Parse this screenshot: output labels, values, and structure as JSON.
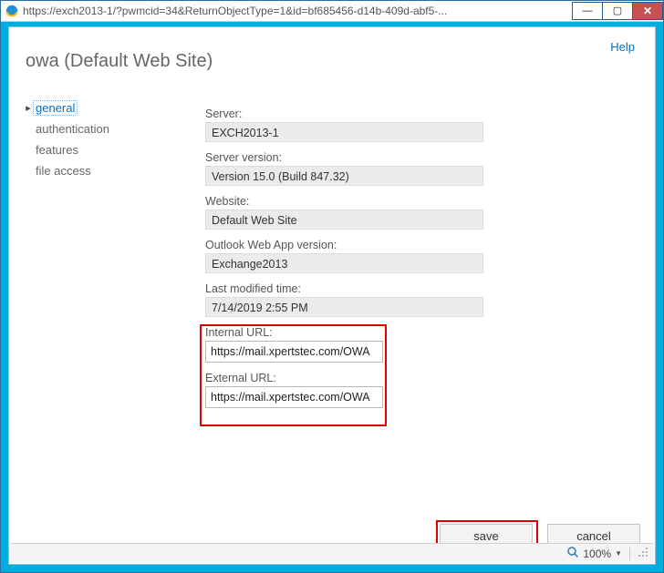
{
  "window": {
    "url": "https://exch2013-1/?pwmcid=34&ReturnObjectType=1&id=bf685456-d14b-409d-abf5-..."
  },
  "header": {
    "help": "Help",
    "title": "owa (Default Web Site)"
  },
  "nav": {
    "items": [
      {
        "label": "general",
        "selected": true
      },
      {
        "label": "authentication",
        "selected": false
      },
      {
        "label": "features",
        "selected": false
      },
      {
        "label": "file access",
        "selected": false
      }
    ]
  },
  "form": {
    "server_label": "Server:",
    "server_value": "EXCH2013-1",
    "server_version_label": "Server version:",
    "server_version_value": "Version 15.0 (Build 847.32)",
    "website_label": "Website:",
    "website_value": "Default Web Site",
    "owa_version_label": "Outlook Web App version:",
    "owa_version_value": "Exchange2013",
    "last_modified_label": "Last modified time:",
    "last_modified_value": "7/14/2019 2:55 PM",
    "internal_url_label": "Internal URL:",
    "internal_url_value": "https://mail.xpertstec.com/OWA",
    "external_url_label": "External URL:",
    "external_url_value": "https://mail.xpertstec.com/OWA"
  },
  "buttons": {
    "save": "save",
    "cancel": "cancel"
  },
  "status": {
    "zoom": "100%"
  }
}
